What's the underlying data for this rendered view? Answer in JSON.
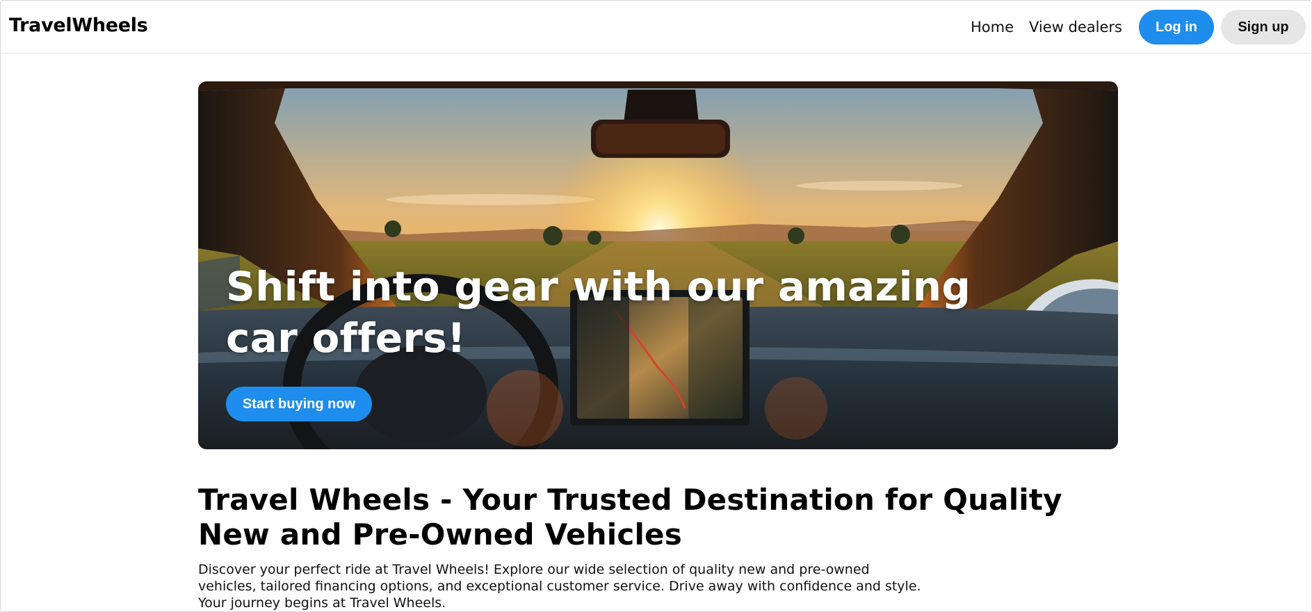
{
  "header": {
    "brand": "TravelWheels",
    "nav": {
      "home": "Home",
      "view_dealers": "View dealers"
    },
    "login_label": "Log in",
    "signup_label": "Sign up"
  },
  "hero": {
    "title": "Shift into gear with our amazing car offers!",
    "cta_label": "Start buying now"
  },
  "main": {
    "headline": "Travel Wheels - Your Trusted Destination for Quality New and Pre-Owned Vehicles",
    "description": "Discover your perfect ride at Travel Wheels! Explore our wide selection of quality new and pre-owned vehicles, tailored financing options, and exceptional customer service. Drive away with confidence and style. Your journey begins at Travel Wheels."
  },
  "colors": {
    "accent": "#1f8ded",
    "secondary_button": "#e6e6e6"
  }
}
